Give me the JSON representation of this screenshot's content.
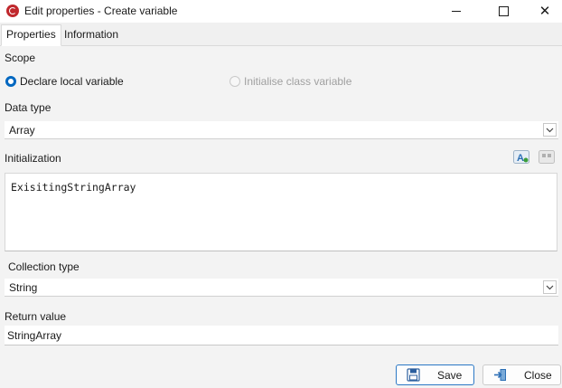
{
  "window": {
    "title": "Edit properties - Create variable",
    "app_icon": "app-logo-icon"
  },
  "tabs": [
    {
      "label": "Properties",
      "active": true
    },
    {
      "label": "Information",
      "active": false
    }
  ],
  "scope": {
    "label": "Scope",
    "options": [
      {
        "label": "Declare local variable",
        "selected": true,
        "enabled": true
      },
      {
        "label": "Initialise class variable",
        "selected": false,
        "enabled": false
      }
    ]
  },
  "data_type": {
    "label": "Data type",
    "value": "Array"
  },
  "initialization": {
    "label": "Initialization",
    "code": "ExisitingStringArray"
  },
  "collection_type": {
    "label": "Collection type",
    "value": "String"
  },
  "return_value": {
    "label": "Return value",
    "value": "StringArray"
  },
  "buttons": {
    "save": "Save",
    "close": "Close"
  },
  "colors": {
    "accent": "#0067c0",
    "brand": "#c0282d"
  }
}
